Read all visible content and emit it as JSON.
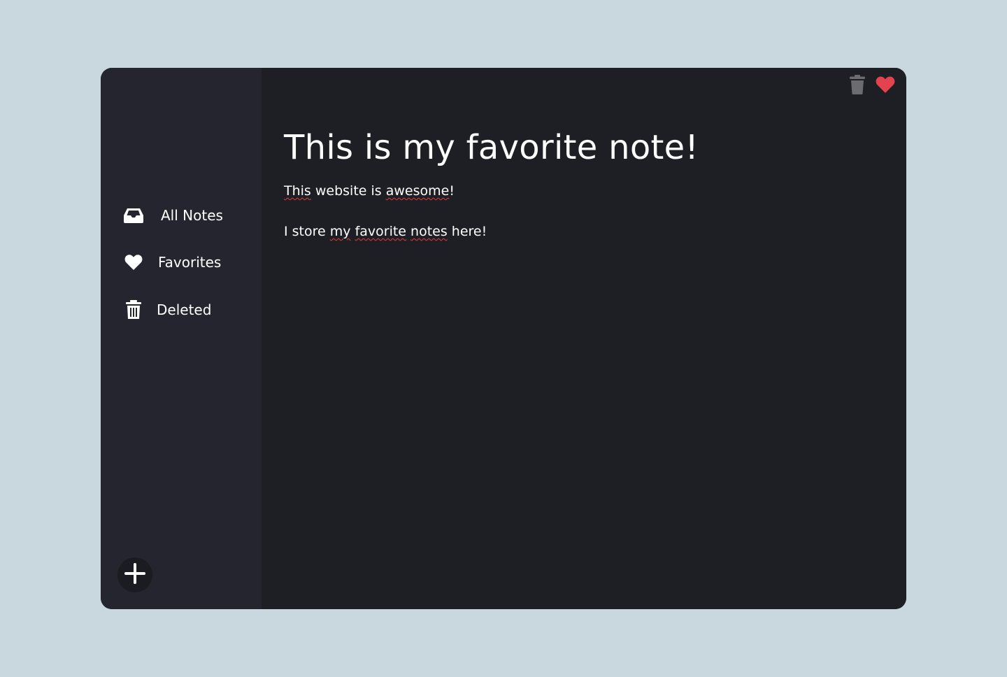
{
  "sidebar": {
    "items": [
      {
        "label": "All Notes",
        "icon": "inbox-icon"
      },
      {
        "label": "Favorites",
        "icon": "heart-icon"
      },
      {
        "label": "Deleted",
        "icon": "trash-icon"
      }
    ],
    "add_button_icon": "plus-icon"
  },
  "toolbar": {
    "delete_icon": "trash-icon",
    "favorite_icon": "heart-icon"
  },
  "note": {
    "title": "This is my favorite note!",
    "line1": {
      "w1": "This",
      "w2": " website is ",
      "w3": "awesome",
      "w4": "!"
    },
    "line2": {
      "w1": "I store ",
      "w2": "my",
      "w3": " ",
      "w4": "favorite",
      "w5": " ",
      "w6": "notes",
      "w7": " here!"
    }
  },
  "colors": {
    "page_background": "#c9d7de",
    "sidebar_background": "#25252f",
    "main_background": "#1e1f24",
    "favorite_accent": "#e5424f",
    "delete_icon_color": "#6b6b70",
    "text": "#ffffff",
    "spellcheck_underline": "#e23b3b"
  }
}
